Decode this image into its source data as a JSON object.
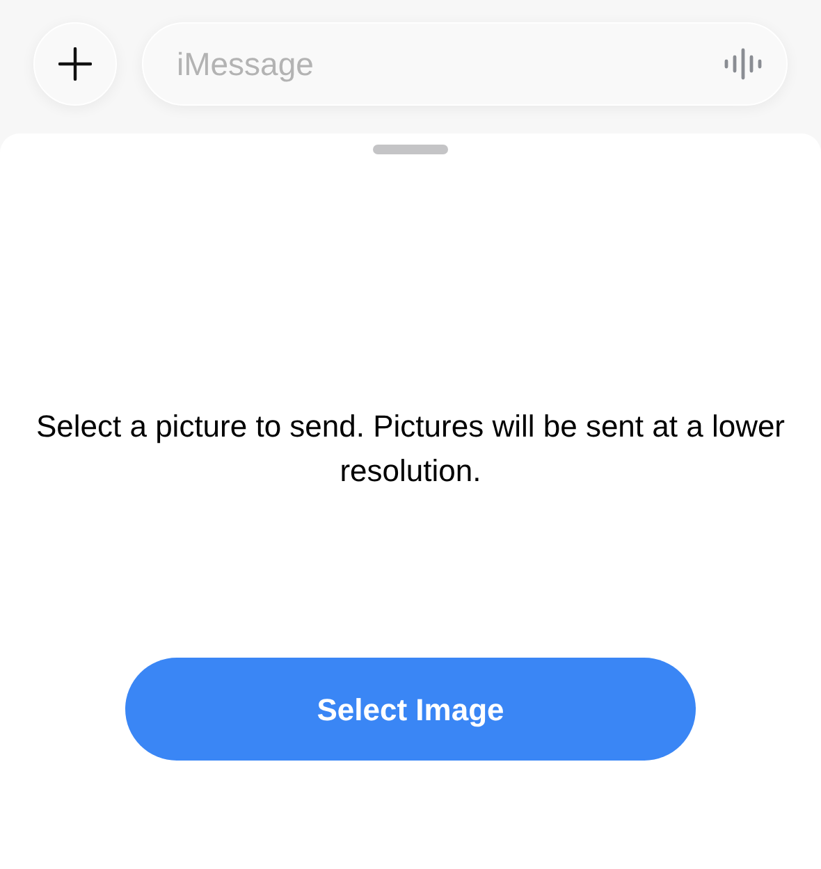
{
  "composer": {
    "placeholder": "iMessage"
  },
  "sheet": {
    "message": "Select a picture to send. Pictures will be sent at a lower resolution.",
    "button": "Select Image"
  }
}
